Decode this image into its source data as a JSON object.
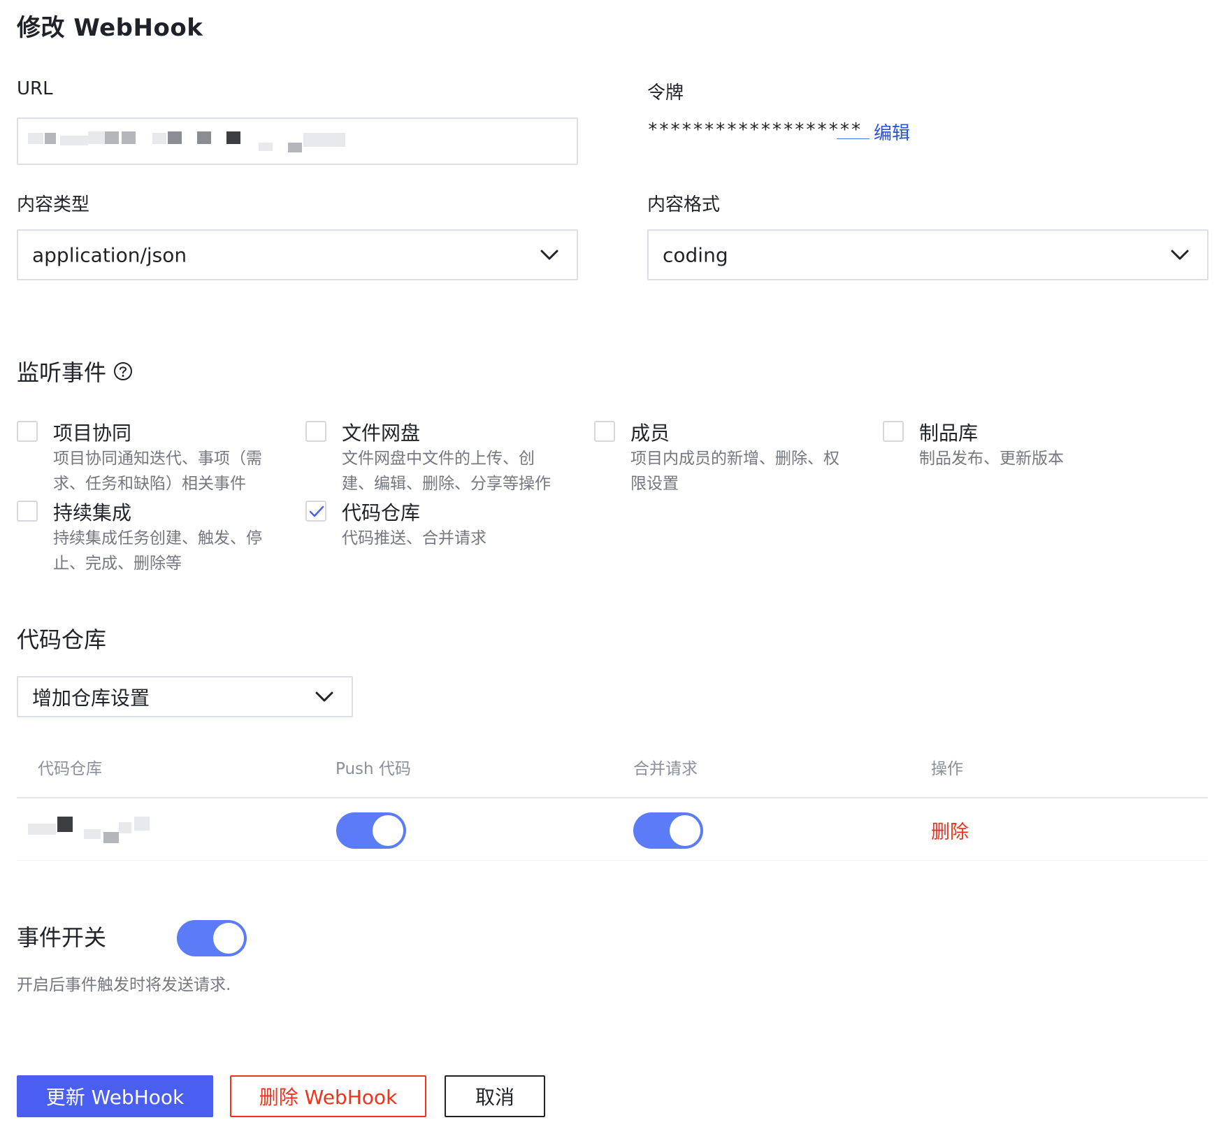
{
  "title": "修改 WebHook",
  "url_field": {
    "label": "URL"
  },
  "token": {
    "label": "令牌",
    "masked": "*******************",
    "dashes": "___",
    "edit_link": "编辑"
  },
  "content_type": {
    "label": "内容类型",
    "value": "application/json"
  },
  "content_format": {
    "label": "内容格式",
    "value": "coding"
  },
  "events": {
    "title": "监听事件",
    "items": [
      {
        "name": "项目协同",
        "desc": "项目协同通知迭代、事项（需求、任务和缺陷）相关事件",
        "checked": false
      },
      {
        "name": "文件网盘",
        "desc": "文件网盘中文件的上传、创建、编辑、删除、分享等操作",
        "checked": false
      },
      {
        "name": "成员",
        "desc": "项目内成员的新增、删除、权限设置",
        "checked": false
      },
      {
        "name": "制品库",
        "desc": "制品发布、更新版本",
        "checked": false
      },
      {
        "name": "持续集成",
        "desc": "持续集成任务创建、触发、停止、完成、删除等",
        "checked": false
      },
      {
        "name": "代码仓库",
        "desc": "代码推送、合并请求",
        "checked": true
      }
    ]
  },
  "repo_section": {
    "title": "代码仓库",
    "add_select": "增加仓库设置",
    "columns": [
      "代码仓库",
      "Push 代码",
      "合并请求",
      "操作"
    ],
    "rows": [
      {
        "push_enabled": true,
        "merge_enabled": true,
        "action": "删除"
      }
    ]
  },
  "event_switch": {
    "label": "事件开关",
    "enabled": true,
    "hint": "开启后事件触发时将发送请求."
  },
  "buttons": {
    "update": "更新 WebHook",
    "delete": "删除 WebHook",
    "cancel": "取消"
  },
  "colors": {
    "primary": "#4a5ef0",
    "toggle_on": "#5b7cf6",
    "danger": "#f0321e",
    "link": "#2b53d6"
  }
}
